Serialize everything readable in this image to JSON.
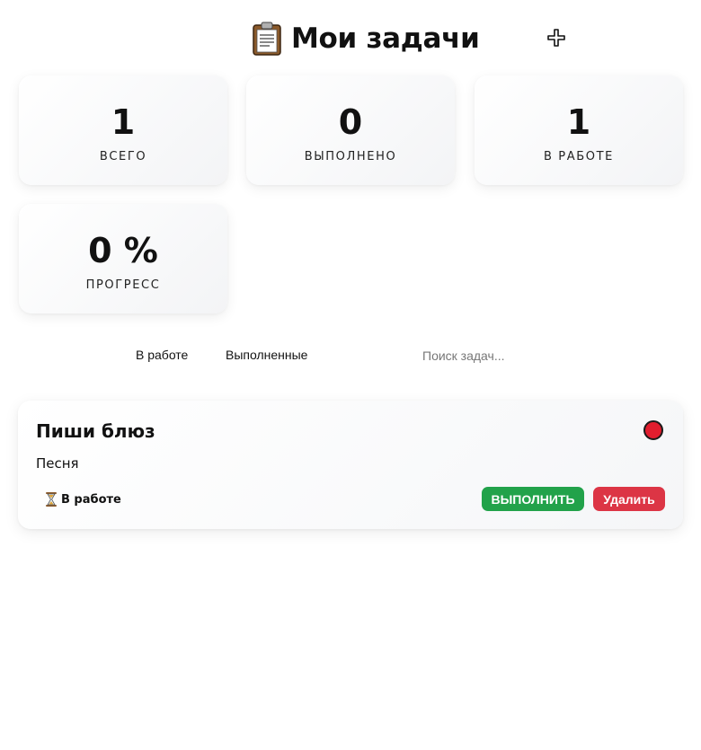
{
  "header": {
    "title": "Мои задачи",
    "title_icon": "clipboard-icon",
    "add_icon": "plus-icon"
  },
  "stats": [
    {
      "value": "1",
      "label": "ВСЕГО"
    },
    {
      "value": "0",
      "label": "ВЫПОЛНЕНО"
    },
    {
      "value": "1",
      "label": "В РАБОТЕ"
    },
    {
      "value": "0 %",
      "label": "ПРОГРЕСС"
    }
  ],
  "filters": {
    "tabs": [
      {
        "label": "В работе"
      },
      {
        "label": "Выполненные"
      }
    ],
    "search_placeholder": "Поиск задач..."
  },
  "tasks": [
    {
      "title": "Пиши блюз",
      "description": "Песня",
      "priority_color": "#e11d2e",
      "status_icon": "hourglass-icon",
      "status": "В работе",
      "complete_label": "ВЫПОЛНИТЬ",
      "delete_label": "Удалить"
    }
  ],
  "colors": {
    "complete": "#22a24a",
    "delete": "#dc3545",
    "priority_high": "#e11d2e"
  }
}
